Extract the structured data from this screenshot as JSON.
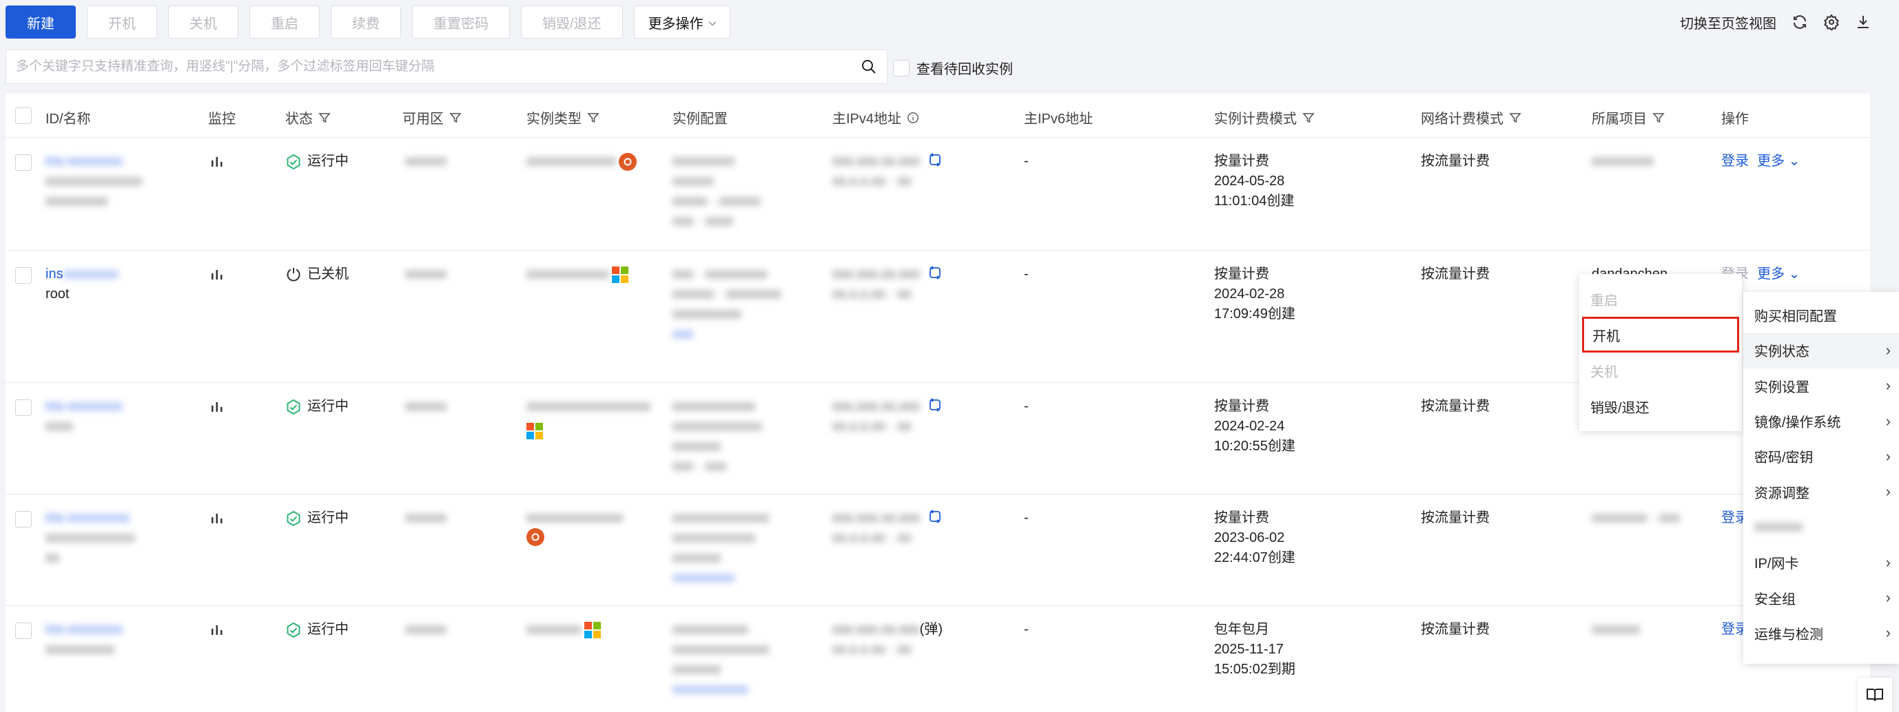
{
  "toolbar": {
    "new": "新建",
    "start": "开机",
    "stop": "关机",
    "restart": "重启",
    "renew": "续费",
    "reset_password": "重置密码",
    "destroy": "销毁/退还",
    "more": "更多操作",
    "switch_view": "切换至页签视图"
  },
  "search": {
    "placeholder": "多个关键字只支持精准查询，用竖线\"|\"分隔，多个过滤标签用回车键分隔",
    "recycle_label": "查看待回收实例"
  },
  "columns": [
    "ID/名称",
    "监控",
    "状态",
    "可用区",
    "实例类型",
    "实例配置",
    "主IPv4地址",
    "主IPv6地址",
    "实例计费模式",
    "网络计费模式",
    "所属项目",
    "操作"
  ],
  "rows": [
    {
      "id": "ins-xxxxxxxx",
      "name_line2": "xxxxxxxxxxxxxx",
      "status": "运行中",
      "status_type": "running",
      "zone": "xxxxxx",
      "type": "xxxxxxxxxxxxx",
      "os": "ubuntu",
      "config": [
        "xxxxxxxxx",
        "xxxxxx",
        "xxxxx · xxxxxx",
        "xxx · xxxx"
      ],
      "ipv4": "xxx.xxx.xx.xxx",
      "ipv4_line2": "xx.x.x.xx · xx",
      "ipv6": "-",
      "billing_mode": "按量计费",
      "billing_date": "2024-05-28",
      "billing_time": "11:01:04创建",
      "network_billing": "按流量计费",
      "project": "xxxxxxxxx",
      "actions": [
        "登录",
        "更多"
      ]
    },
    {
      "id": "ins",
      "id_blur": "xxxxxxxx",
      "name_line2": "root",
      "status": "已关机",
      "status_type": "stopped",
      "zone": "xxxxxx",
      "type": "xxxxxxxxxxxx",
      "os": "windows",
      "config": [
        "xxx · xxxxxxxxx",
        "xxxxxx · xxxxxxxx",
        "xxxxxxxxxx",
        "xxx"
      ],
      "ipv4": "xxx.xxx.xx.xxx",
      "ipv4_line2": "xx.x.x.xx · xx",
      "ipv6": "-",
      "billing_mode": "按量计费",
      "billing_date": "2024-02-28",
      "billing_time": "17:09:49创建",
      "network_billing": "按流量计费",
      "project": "dandanchen",
      "actions": [
        "登录",
        "更多"
      ]
    },
    {
      "id": "ins-xxxxxxxx",
      "name_line2": "xxxx",
      "status": "运行中",
      "status_type": "running",
      "zone": "xxxxxx",
      "type": "xxxxxxxxxxxxxxxxxx",
      "os": "windows",
      "config": [
        "xxxxxxxxxxxx",
        "xxxxxxxxxxxxx",
        "xxxxxxx",
        "xxx · xxx"
      ],
      "ipv4": "xxx.xxx.xx.xxx",
      "ipv4_line2": "xx.x.x.xx · xx",
      "ipv6": "-",
      "billing_mode": "按量计费",
      "billing_date": "2024-02-24",
      "billing_time": "10:20:55创建",
      "network_billing": "按流量计费",
      "project": "",
      "actions": []
    },
    {
      "id": "ins-xxxxxxxxx",
      "name_line2": "xxxxxxxxxxxxx",
      "status": "运行中",
      "status_type": "running",
      "zone": "xxxxxx",
      "type": "xxxxxxxxxxxxxx",
      "os": "ubuntu",
      "config": [
        "xxxxxxxxxxxxxx",
        "xxxxxxxxxxxx",
        "xxxxxxx",
        "xxxxxxxxx"
      ],
      "ipv4": "xxx.xxx.xx.xxx",
      "ipv4_line2": "xx.x.x.xx · xx",
      "ipv6": "-",
      "billing_mode": "按量计费",
      "billing_date": "2023-06-02",
      "billing_time": "22:44:07创建",
      "network_billing": "按流量计费",
      "project": "xxxxxxxx · xxx",
      "actions": [
        "登录"
      ]
    },
    {
      "id": "ins-xxxxxxxx",
      "name_line2": "xxxxxxxxxx",
      "status": "运行中",
      "status_type": "running",
      "zone": "xxxxxx",
      "type": "xxxxxxxx",
      "os": "windows",
      "config": [
        "xxxxxxxxxxx",
        "xxxxxxxxxxxxxx",
        "xxxxxxx",
        "xxxxxxxxxxx"
      ],
      "ipv4": "xxx.xxx.xx.xxx",
      "ipv4_suffix": "(弹)",
      "ipv4_line2": "xx.x.x.xx · xx",
      "ipv6": "-",
      "billing_mode": "包年包月",
      "billing_date": "2025-11-17",
      "billing_time": "15:05:02到期",
      "network_billing": "按流量计费",
      "project": "xxxxxxx",
      "actions": [
        "登录"
      ]
    }
  ],
  "submenu": {
    "items": [
      {
        "label": "重启",
        "state": "disabled"
      },
      {
        "label": "开机",
        "state": "selected"
      },
      {
        "label": "关机",
        "state": "disabled"
      },
      {
        "label": "销毁/退还",
        "state": "normal"
      }
    ]
  },
  "mainmenu": {
    "items": [
      {
        "label": "购买相同配置",
        "arrow": false
      },
      {
        "label": "实例状态",
        "arrow": true,
        "active": true
      },
      {
        "label": "实例设置",
        "arrow": true
      },
      {
        "label": "镜像/操作系统",
        "arrow": true
      },
      {
        "label": "密码/密钥",
        "arrow": true
      },
      {
        "label": "资源调整",
        "arrow": true
      },
      {
        "label": "xxxxxxx",
        "arrow": false,
        "blur": true
      },
      {
        "label": "IP/网卡",
        "arrow": true
      },
      {
        "label": "安全组",
        "arrow": true
      },
      {
        "label": "运维与检测",
        "arrow": true
      }
    ]
  },
  "colors": {
    "primary": "#1d5bd8",
    "running_green": "#2bb673",
    "highlight_red": "#e1251b"
  }
}
